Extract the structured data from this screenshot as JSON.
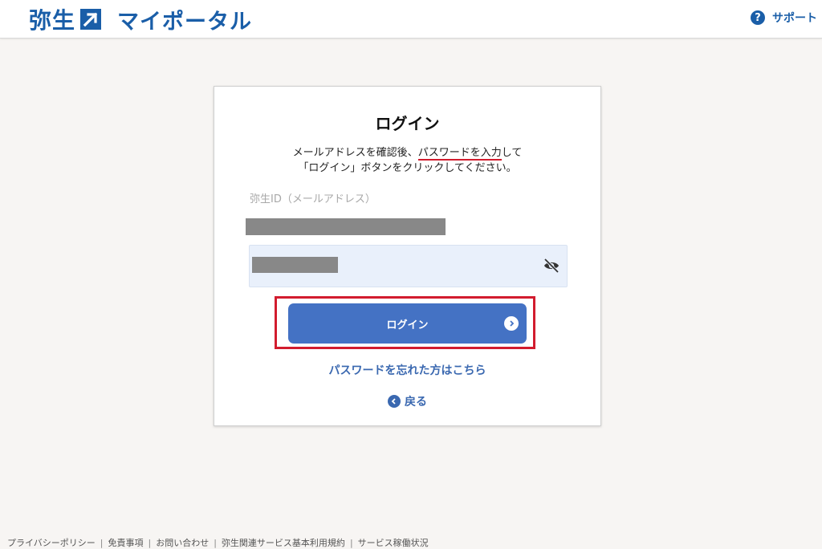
{
  "header": {
    "logo_text": "弥生",
    "portal_title": "マイポータル",
    "support_label": "サポート",
    "support_icon": "?"
  },
  "card": {
    "title": "ログイン",
    "instruction_line1_pre": "メールアドレスを確認後、",
    "instruction_line1_highlight": "パスワードを入力",
    "instruction_line1_post": "して",
    "instruction_line2": "「ログイン」ボタンをクリックしてください。",
    "id_label": "弥生ID（メールアドレス）",
    "login_button_label": "ログイン",
    "forgot_password_link": "パスワードを忘れた方はこちら",
    "back_link": "戻る"
  },
  "footer": {
    "links": [
      "プライバシーポリシー",
      "免責事項",
      "お問い合わせ",
      "弥生関連サービス基本利用規約",
      "サービス稼働状況"
    ]
  },
  "colors": {
    "brand_blue": "#1a5ea8",
    "button_blue": "#4472c4",
    "highlight_red": "#d21c2e",
    "field_bg": "#e9f0fb"
  },
  "icons": {
    "support": "question-circle-icon",
    "password_toggle": "eye-slash-icon",
    "button_arrow": "chevron-right-circle-icon",
    "back": "chevron-left-circle-icon"
  }
}
